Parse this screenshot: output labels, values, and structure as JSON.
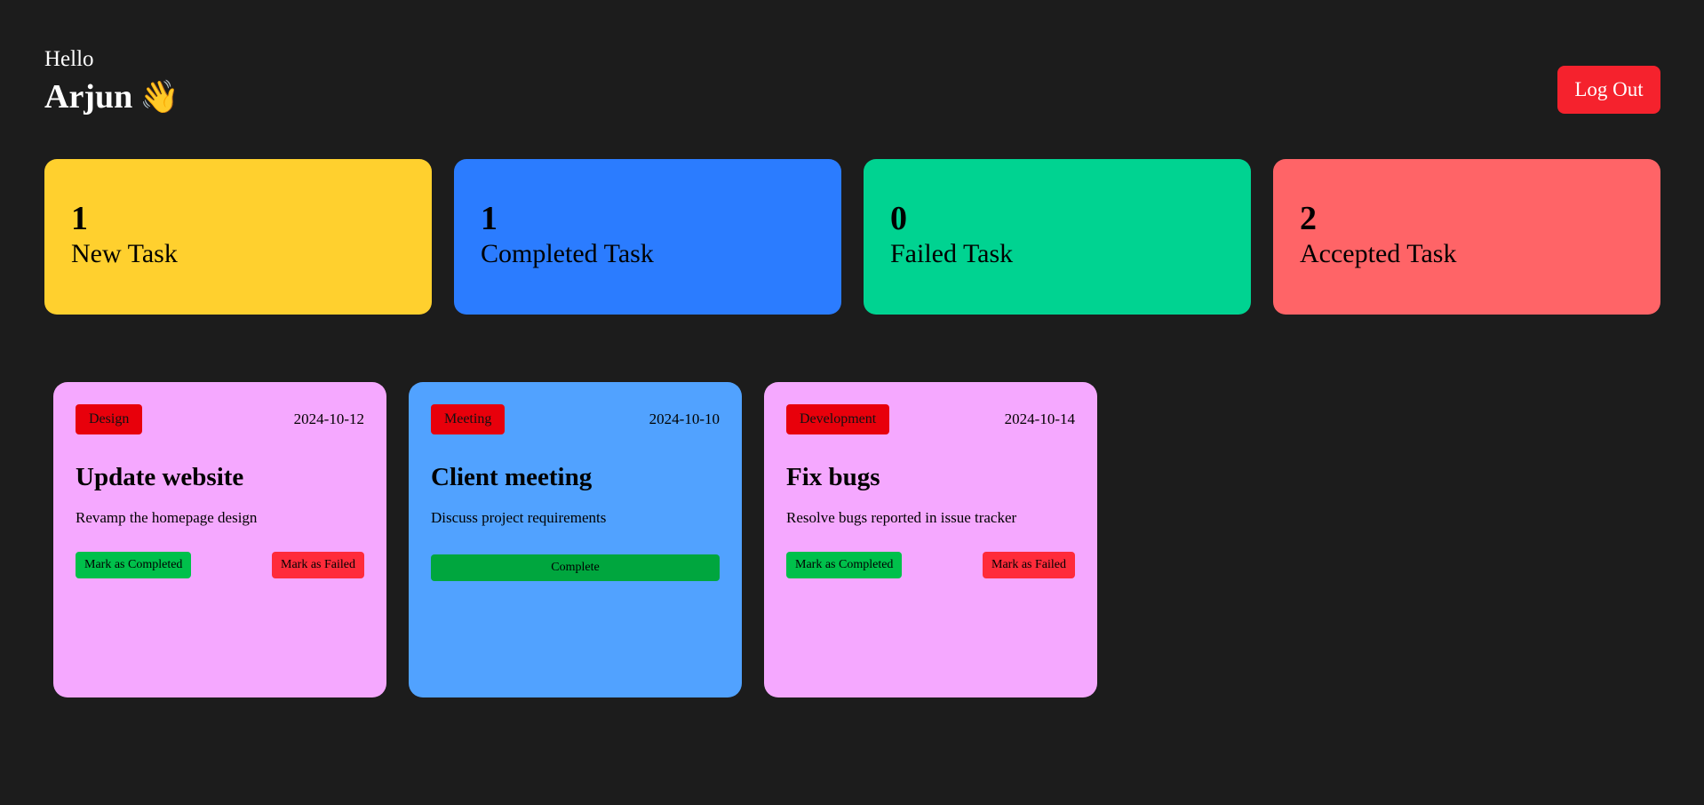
{
  "header": {
    "hello": "Hello",
    "name": "Arjun",
    "wave_emoji": "👋",
    "logout_label": "Log Out"
  },
  "stats": [
    {
      "count": "1",
      "label": "New Task",
      "color": "#ffd02e"
    },
    {
      "count": "1",
      "label": "Completed Task",
      "color": "#2b7cff"
    },
    {
      "count": "0",
      "label": "Failed Task",
      "color": "#00d391"
    },
    {
      "count": "2",
      "label": "Accepted Task",
      "color": "#ff6467"
    }
  ],
  "tasks": [
    {
      "category": "Design",
      "date": "2024-10-12",
      "title": "Update website",
      "description": "Revamp the homepage design",
      "color": "#f5a8ff",
      "complete_label": "Mark as Completed",
      "fail_label": "Mark as Failed"
    },
    {
      "category": "Meeting",
      "date": "2024-10-10",
      "title": "Client meeting",
      "description": "Discuss project requirements",
      "color": "#51a2ff",
      "status_label": "Complete"
    },
    {
      "category": "Development",
      "date": "2024-10-14",
      "title": "Fix bugs",
      "description": "Resolve bugs reported in issue tracker",
      "color": "#f5a8ff",
      "complete_label": "Mark as Completed",
      "fail_label": "Mark as Failed"
    }
  ],
  "colors": {
    "background": "#1c1c1c",
    "logout": "#f5222d",
    "tag": "#e8000b"
  }
}
